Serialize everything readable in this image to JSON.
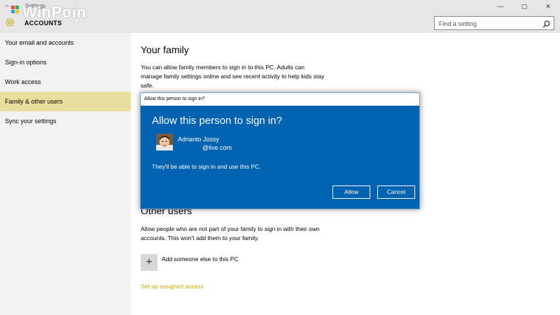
{
  "window": {
    "app_title": "Settings",
    "back_glyph": "←",
    "minimize_glyph": "—",
    "maximize_glyph": "▢",
    "close_glyph": "✕"
  },
  "watermark": {
    "text": "WinPoin"
  },
  "header": {
    "section_title": "ACCOUNTS",
    "section_icon": "gear-icon",
    "accent_color": "#c9a800"
  },
  "search": {
    "placeholder": "Find a setting",
    "icon": "search-icon"
  },
  "sidebar": {
    "items": [
      {
        "label": "Your email and accounts",
        "active": false
      },
      {
        "label": "Sign-in options",
        "active": false
      },
      {
        "label": "Work access",
        "active": false
      },
      {
        "label": "Family & other users",
        "active": true
      },
      {
        "label": "Sync your settings",
        "active": false
      }
    ],
    "active_color": "#e8df9c"
  },
  "main": {
    "family_heading": "Your family",
    "family_text": "You can allow family members to sign in to this PC. Adults can manage family settings online and see recent activity to help kids stay safe.",
    "other_heading": "Other users",
    "other_text": "Allow people who are not part of your family to sign in with their own accounts. This won't add them to your family.",
    "add_glyph": "+",
    "add_label": "Add someone else to this PC",
    "assigned_access_link": "Set up assigned access"
  },
  "dialog": {
    "window_title": "Allow this person to sign in?",
    "heading": "Allow this person to sign in?",
    "user_name": "Adrianto Jossy",
    "user_email": "@live.com",
    "description": "They'll be able to sign in and use this PC.",
    "allow_label": "Allow",
    "cancel_label": "Cancel",
    "background_color": "#0063b1"
  }
}
